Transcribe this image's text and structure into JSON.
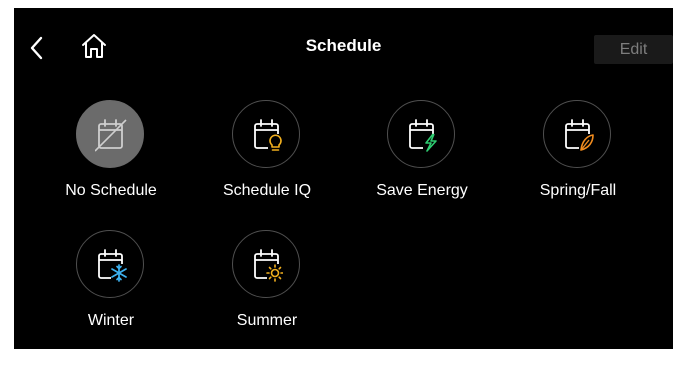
{
  "header": {
    "title": "Schedule",
    "edit_label": "Edit",
    "back_icon": "chevron-left-icon",
    "home_icon": "home-icon"
  },
  "schedules": [
    {
      "label": "No Schedule",
      "icon": "calendar-off-icon",
      "selected": true
    },
    {
      "label": "Schedule IQ",
      "icon": "calendar-lightbulb-icon",
      "accent": "#f2b01e"
    },
    {
      "label": "Save Energy",
      "icon": "calendar-lightning-icon",
      "accent": "#2ecc71"
    },
    {
      "label": "Spring/Fall",
      "icon": "calendar-leaf-icon",
      "accent": "#f28c1e"
    },
    {
      "label": "Winter",
      "icon": "calendar-snowflake-icon",
      "accent": "#3db2f0"
    },
    {
      "label": "Summer",
      "icon": "calendar-sun-icon",
      "accent": "#f2b01e"
    }
  ],
  "colors": {
    "background": "#000000",
    "selected_circle": "#6b6b6b",
    "edit_text": "#7d7d7d"
  }
}
